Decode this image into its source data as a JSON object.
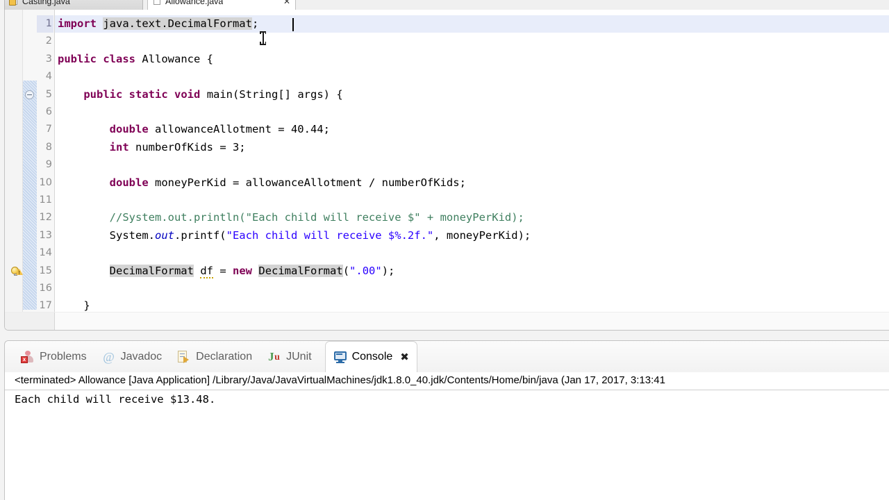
{
  "editor": {
    "tabs": [
      {
        "label": "Casting.java",
        "icon": "java-file-warning-icon",
        "active": false,
        "closable": false
      },
      {
        "label": "Allowance.java",
        "icon": "java-file-icon",
        "active": true,
        "closable": true,
        "close_glyph": "✕"
      }
    ],
    "lines": [
      {
        "num": "1",
        "text": "import java.text.DecimalFormat;"
      },
      {
        "num": "2",
        "text": ""
      },
      {
        "num": "3",
        "text": "public class Allowance {"
      },
      {
        "num": "4",
        "text": ""
      },
      {
        "num": "5",
        "text": "    public static void main(String[] args) {"
      },
      {
        "num": "6",
        "text": ""
      },
      {
        "num": "7",
        "text": "        double allowanceAllotment = 40.44;"
      },
      {
        "num": "8",
        "text": "        int numberOfKids = 3;"
      },
      {
        "num": "9",
        "text": ""
      },
      {
        "num": "10",
        "text": "        double moneyPerKid = allowanceAllotment / numberOfKids;"
      },
      {
        "num": "11",
        "text": ""
      },
      {
        "num": "12",
        "text": "        //System.out.println(\"Each child will receive $\" + moneyPerKid);"
      },
      {
        "num": "13",
        "text": "        System.out.printf(\"Each child will receive $%.2f.\", moneyPerKid);"
      },
      {
        "num": "14",
        "text": ""
      },
      {
        "num": "15",
        "text": "        DecimalFormat df = new DecimalFormat(\".00\");"
      },
      {
        "num": "16",
        "text": ""
      },
      {
        "num": "17",
        "text": "    }"
      }
    ],
    "current_line": "1",
    "warning_line": "15",
    "fold_line": "5"
  },
  "view": {
    "tabs": [
      {
        "label": "Problems",
        "icon": "problems-icon",
        "active": false
      },
      {
        "label": "Javadoc",
        "icon": "javadoc-icon",
        "active": false
      },
      {
        "label": "Declaration",
        "icon": "declaration-icon",
        "active": false
      },
      {
        "label": "JUnit",
        "icon": "junit-icon",
        "active": false
      },
      {
        "label": "Console",
        "icon": "console-icon",
        "active": true,
        "close_glyph": "✖"
      }
    ],
    "console": {
      "header": "<terminated> Allowance [Java Application] /Library/Java/JavaVirtualMachines/jdk1.8.0_40.jdk/Contents/Home/bin/java (Jan 17, 2017, 3:13:41",
      "output": "Each child will receive $13.48."
    }
  },
  "colors": {
    "keyword": "#7F0055",
    "comment": "#3F7F5F",
    "string": "#2A00FF",
    "static_field": "#0000C0",
    "occurrence_highlight": "#D4D4D4",
    "current_line": "#E8EDFA",
    "selection": "#D6E2F5"
  }
}
